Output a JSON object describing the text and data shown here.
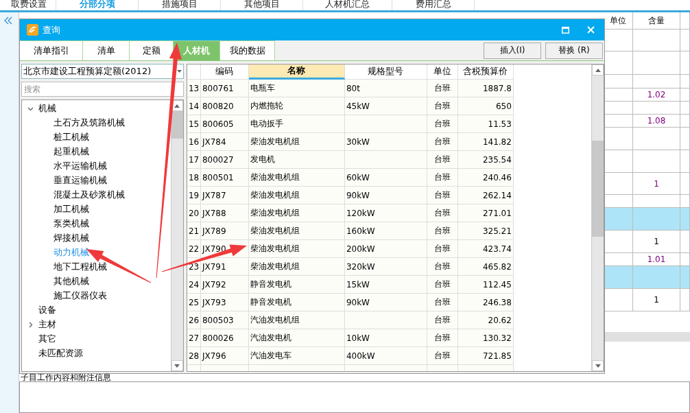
{
  "app_tabs": [
    {
      "label": "取费设置",
      "selected": false
    },
    {
      "label": "分部分项",
      "selected": true
    },
    {
      "label": "措施项目",
      "selected": false
    },
    {
      "label": "其他项目",
      "selected": false
    },
    {
      "label": "人材机汇总",
      "selected": false
    },
    {
      "label": "费用汇总",
      "selected": false
    }
  ],
  "background_table": {
    "columns": [
      "单位",
      "含量"
    ],
    "rows": [
      {
        "amount": "",
        "highlighted": false
      },
      {
        "amount": "",
        "highlighted": false
      },
      {
        "amount": "",
        "highlighted": false
      },
      {
        "amount": "1.02",
        "highlighted": false,
        "color": "#800080"
      },
      {
        "amount": "",
        "highlighted": false
      },
      {
        "amount": "1.08",
        "highlighted": false,
        "color": "#800080"
      },
      {
        "amount": "",
        "highlighted": false
      },
      {
        "amount": "",
        "highlighted": false
      },
      {
        "amount": "1",
        "highlighted": false,
        "color": "#800080"
      },
      {
        "amount": "",
        "highlighted": false
      },
      {
        "amount": "",
        "highlighted": true
      },
      {
        "amount": "1",
        "highlighted": false,
        "color": "#000000"
      },
      {
        "amount": "1.01",
        "highlighted": false,
        "color": "#800080"
      },
      {
        "amount": "",
        "highlighted": true
      },
      {
        "amount": "1",
        "highlighted": false,
        "color": "#000000"
      }
    ]
  },
  "notes_label": "子目工作内容和附注信息",
  "dialog": {
    "title": "查询",
    "tabs": [
      {
        "label": "清单指引",
        "selected": false
      },
      {
        "label": "清单",
        "selected": false
      },
      {
        "label": "定额",
        "selected": false
      },
      {
        "label": "人材机",
        "selected": true
      },
      {
        "label": "我的数据",
        "selected": false
      }
    ],
    "buttons": [
      "插入(I)",
      "替换 (R)"
    ],
    "library": "北京市建设工程预算定额(2012)",
    "search_placeholder": "搜索",
    "tree": [
      {
        "label": "机械",
        "expanded": true,
        "selected": false,
        "children": [
          {
            "label": "土石方及筑路机械",
            "selected": false
          },
          {
            "label": "桩工机械",
            "selected": false
          },
          {
            "label": "起重机械",
            "selected": false
          },
          {
            "label": "水平运输机械",
            "selected": false
          },
          {
            "label": "垂直运输机械",
            "selected": false
          },
          {
            "label": "混凝土及砂浆机械",
            "selected": false
          },
          {
            "label": "加工机械",
            "selected": false
          },
          {
            "label": "泵类机械",
            "selected": false
          },
          {
            "label": "焊接机械",
            "selected": false
          },
          {
            "label": "动力机械",
            "selected": true
          },
          {
            "label": "地下工程机械",
            "selected": false
          },
          {
            "label": "其他机械",
            "selected": false
          },
          {
            "label": "施工仪器仪表",
            "selected": false
          }
        ]
      },
      {
        "label": "设备",
        "selected": false
      },
      {
        "label": "主材",
        "expanded": false,
        "selected": false
      },
      {
        "label": "其它",
        "selected": false
      },
      {
        "label": "未匹配资源",
        "selected": false
      }
    ],
    "table": {
      "columns": [
        {
          "selected": false
        },
        {
          "label": "编码",
          "selected": false
        },
        {
          "label": "名称",
          "selected": true
        },
        {
          "label": "规格型号",
          "selected": false
        },
        {
          "label": "单位",
          "selected": false
        },
        {
          "label": "含税预算价",
          "selected": false
        }
      ],
      "rows": [
        [
          "13",
          "800761",
          "电瓶车",
          "80t",
          "台班",
          "1887.8"
        ],
        [
          "14",
          "800820",
          "内燃拖轮",
          "45kW",
          "台班",
          "650"
        ],
        [
          "15",
          "800605",
          "电动扳手",
          "",
          "台班",
          "11.53"
        ],
        [
          "16",
          "JX784",
          "柴油发电机组",
          "30kW",
          "台班",
          "141.82"
        ],
        [
          "17",
          "800027",
          "发电机",
          "",
          "台班",
          "235.54"
        ],
        [
          "18",
          "800501",
          "柴油发电机组",
          "60kW",
          "台班",
          "240.46"
        ],
        [
          "19",
          "JX787",
          "柴油发电机组",
          "90kW",
          "台班",
          "262.14"
        ],
        [
          "20",
          "JX788",
          "柴油发电机组",
          "120kW",
          "台班",
          "271.01"
        ],
        [
          "21",
          "JX789",
          "柴油发电机组",
          "160kW",
          "台班",
          "325.21"
        ],
        [
          "22",
          "JX790",
          "柴油发电机组",
          "200kW",
          "台班",
          "423.74"
        ],
        [
          "23",
          "JX791",
          "柴油发电机组",
          "320kW",
          "台班",
          "465.82"
        ],
        [
          "24",
          "JX792",
          "静音发电机",
          "15kW",
          "台班",
          "112.45"
        ],
        [
          "25",
          "JX793",
          "静音发电机",
          "90kW",
          "台班",
          "246.38"
        ],
        [
          "26",
          "800503",
          "汽油发电机组",
          "",
          "台班",
          "20.62"
        ],
        [
          "27",
          "800026",
          "汽油发电机",
          "10kW",
          "台班",
          "130.32"
        ],
        [
          "28",
          "JX796",
          "汽油发电车",
          "400kW",
          "台班",
          "721.85"
        ]
      ]
    }
  }
}
